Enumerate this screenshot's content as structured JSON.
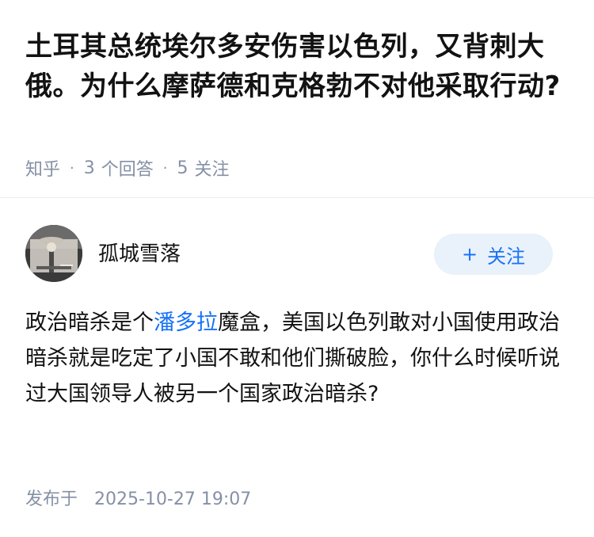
{
  "question": {
    "title": "土耳其总统埃尔多安伤害以色列，又背刺大俄。为什么摩萨德和克格勃不对他采取行动?",
    "source": "知乎",
    "separator": "·",
    "answer_count": "3",
    "answer_label": "个回答",
    "follow_count": "5",
    "follow_label": "关注"
  },
  "author": {
    "name": "孤城雪落",
    "follow_plus": "+",
    "follow_label": "关注"
  },
  "answer": {
    "text_before_link": "政治暗杀是个",
    "link_text": "潘多拉",
    "text_after_link": "魔盒，美国以色列敢对小国使用政治暗杀就是吃定了小国不敢和他们撕破脸，你什么时候听说过大国领导人被另一个国家政治暗杀?",
    "published_label": "发布于",
    "published_time": "2025-10-27 19:07"
  },
  "colors": {
    "link": "#1772f6",
    "meta": "#8590a6",
    "follow_bg": "#e9f1fb",
    "text": "#121212"
  }
}
